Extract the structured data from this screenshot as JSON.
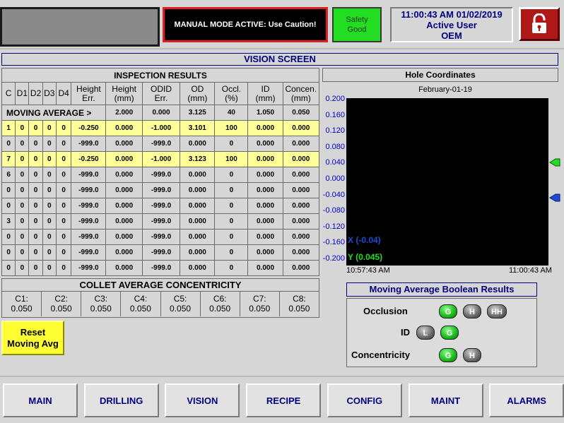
{
  "header": {
    "alarm_message": "MANUAL MODE ACTIVE: Use Caution!",
    "safety_line1": "Safety",
    "safety_line2": "Good",
    "datetime": "11:00:43 AM 01/02/2019",
    "user_line1": "Active User",
    "user_line2": "OEM",
    "lock_icon": "padlock-icon"
  },
  "screen_title": "VISION SCREEN",
  "inspection": {
    "title": "INSPECTION RESULTS",
    "columns": [
      "C",
      "D1",
      "D2",
      "D3",
      "D4",
      "Height\nErr.",
      "Height\n(mm)",
      "ODID\nErr.",
      "OD\n(mm)",
      "Occl.\n(%)",
      "ID\n(mm)",
      "Concen.\n(mm)"
    ],
    "moving_average": {
      "label": "MOVING AVERAGE >",
      "values": [
        "2.000",
        "0.000",
        "3.125",
        "40",
        "1.050",
        "0.050"
      ]
    },
    "rows": [
      {
        "highlight": true,
        "cells": [
          "1",
          "0",
          "0",
          "0",
          "0",
          "-0.250",
          "0.000",
          "-1.000",
          "3.101",
          "100",
          "0.000",
          "0.000"
        ]
      },
      {
        "highlight": false,
        "cells": [
          "0",
          "0",
          "0",
          "0",
          "0",
          "-999.0",
          "0.000",
          "-999.0",
          "0.000",
          "0",
          "0.000",
          "0.000"
        ]
      },
      {
        "highlight": true,
        "cells": [
          "7",
          "0",
          "0",
          "0",
          "0",
          "-0.250",
          "0.000",
          "-1.000",
          "3.123",
          "100",
          "0.000",
          "0.000"
        ]
      },
      {
        "highlight": false,
        "cells": [
          "6",
          "0",
          "0",
          "0",
          "0",
          "-999.0",
          "0.000",
          "-999.0",
          "0.000",
          "0",
          "0.000",
          "0.000"
        ]
      },
      {
        "highlight": false,
        "cells": [
          "0",
          "0",
          "0",
          "0",
          "0",
          "-999.0",
          "0.000",
          "-999.0",
          "0.000",
          "0",
          "0.000",
          "0.000"
        ]
      },
      {
        "highlight": false,
        "cells": [
          "0",
          "0",
          "0",
          "0",
          "0",
          "-999.0",
          "0.000",
          "-999.0",
          "0.000",
          "0",
          "0.000",
          "0.000"
        ]
      },
      {
        "highlight": false,
        "cells": [
          "3",
          "0",
          "0",
          "0",
          "0",
          "-999.0",
          "0.000",
          "-999.0",
          "0.000",
          "0",
          "0.000",
          "0.000"
        ]
      },
      {
        "highlight": false,
        "cells": [
          "0",
          "0",
          "0",
          "0",
          "0",
          "-999.0",
          "0.000",
          "-999.0",
          "0.000",
          "0",
          "0.000",
          "0.000"
        ]
      },
      {
        "highlight": false,
        "cells": [
          "0",
          "0",
          "0",
          "0",
          "0",
          "-999.0",
          "0.000",
          "-999.0",
          "0.000",
          "0",
          "0.000",
          "0.000"
        ]
      },
      {
        "highlight": false,
        "cells": [
          "0",
          "0",
          "0",
          "0",
          "0",
          "-999.0",
          "0.000",
          "-999.0",
          "0.000",
          "0",
          "0.000",
          "0.000"
        ]
      }
    ]
  },
  "collet": {
    "title": "COLLET AVERAGE CONCENTRICITY",
    "items": [
      {
        "label": "C1:",
        "value": "0.050"
      },
      {
        "label": "C2:",
        "value": "0.050"
      },
      {
        "label": "C3:",
        "value": "0.050"
      },
      {
        "label": "C4:",
        "value": "0.050"
      },
      {
        "label": "C5:",
        "value": "0.050"
      },
      {
        "label": "C6:",
        "value": "0.050"
      },
      {
        "label": "C7:",
        "value": "0.050"
      },
      {
        "label": "C8:",
        "value": "0.050"
      }
    ]
  },
  "reset_button": {
    "line1": "Reset",
    "line2": "Moving Avg"
  },
  "hole_coordinates": {
    "title": "Hole Coordinates",
    "date": "February-01-19",
    "y_ticks": [
      "0.200",
      "0.160",
      "0.120",
      "0.080",
      "0.040",
      "0.000",
      "-0.040",
      "-0.080",
      "-0.120",
      "-0.160",
      "-0.200"
    ],
    "x_start": "10:57:43 AM",
    "x_end": "11:00:43 AM",
    "x_series_label": "X (-0.04)",
    "y_series_label": "Y (0.045)"
  },
  "chart_data": {
    "type": "line",
    "title": "Hole Coordinates",
    "subtitle": "February-01-19",
    "ylim": [
      -0.2,
      0.2
    ],
    "y_ticks": [
      0.2,
      0.16,
      0.12,
      0.08,
      0.04,
      0.0,
      -0.04,
      -0.08,
      -0.12,
      -0.16,
      -0.2
    ],
    "x_range": [
      "10:57:43 AM",
      "11:00:43 AM"
    ],
    "series": [
      {
        "name": "X",
        "current_value": -0.04,
        "color": "#1e4bd0"
      },
      {
        "name": "Y",
        "current_value": 0.045,
        "color": "#22dd22"
      }
    ],
    "grid": false
  },
  "boolean_results": {
    "title": "Moving Average Boolean Results",
    "rows": [
      {
        "label": "Occlusion",
        "pills": [
          {
            "text": "G",
            "state": "g"
          },
          {
            "text": "H",
            "state": "n"
          },
          {
            "text": "HH",
            "state": "n"
          }
        ]
      },
      {
        "label": "ID",
        "pills": [
          {
            "text": "L",
            "state": "n"
          },
          {
            "text": "G",
            "state": "g"
          }
        ]
      },
      {
        "label": "Concentricity",
        "pills": [
          {
            "text": "G",
            "state": "g"
          },
          {
            "text": "H",
            "state": "n"
          }
        ]
      }
    ]
  },
  "nav": [
    "MAIN",
    "DRILLING",
    "VISION",
    "RECIPE",
    "CONFIG",
    "MAINT",
    "ALARMS"
  ],
  "colors": {
    "accent": "#000080",
    "highlight_row": "#ffff99",
    "alarm_border": "#e02020",
    "safety": "#22dd22",
    "lock": "#b01818"
  }
}
